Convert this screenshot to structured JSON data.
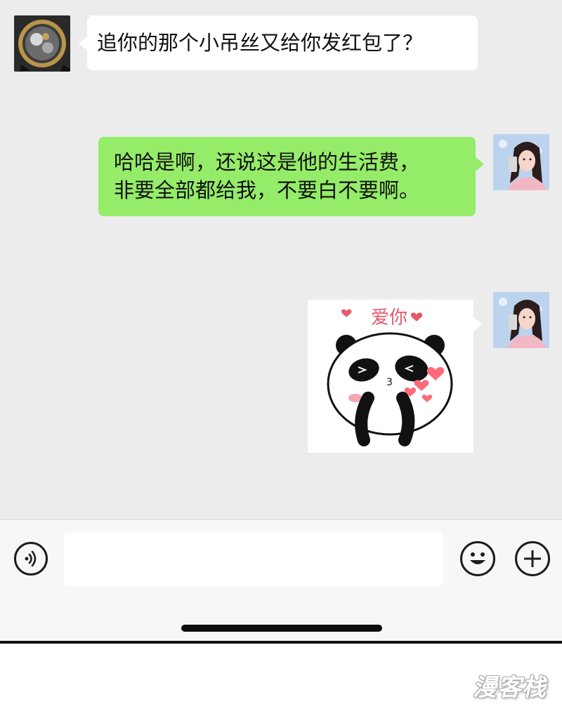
{
  "messages": [
    {
      "sender": "contact",
      "avatar_icon": "watch-avatar-icon",
      "lines": [
        "追你的那个小吊丝又给你发红包了？"
      ]
    },
    {
      "sender": "self",
      "avatar_icon": "girl-avatar-icon",
      "lines": [
        "哈哈是啊，还说这是他的生活费，",
        "非要全部都给我，不要白不要啊。"
      ]
    },
    {
      "sender": "self",
      "avatar_icon": "girl-avatar-icon",
      "sticker": {
        "icon": "panda-love-sticker-icon",
        "caption": "爱你"
      }
    }
  ],
  "input_bar": {
    "voice_icon": "voice-icon",
    "emoji_icon": "emoji-icon",
    "plus_icon": "plus-icon",
    "text_value": ""
  },
  "watermark": "漫客栈",
  "colors": {
    "chat_background": "#ececec",
    "outgoing_bubble": "#95ec69",
    "incoming_bubble": "#ffffff"
  }
}
